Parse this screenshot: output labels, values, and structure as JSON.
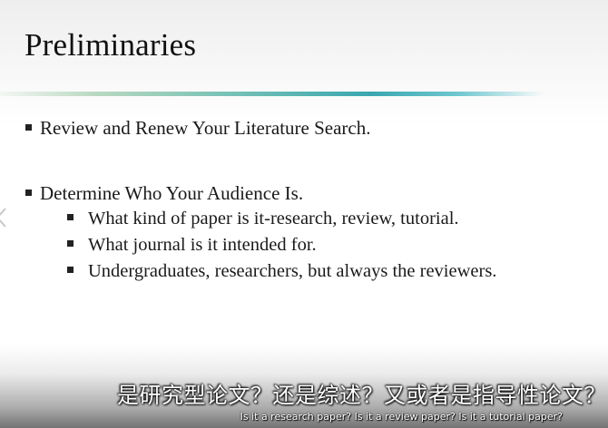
{
  "slide": {
    "title": "Preliminaries",
    "bullets": [
      {
        "text": "Review and Renew Your Literature Search."
      },
      {
        "text": "Determine Who Your Audience Is."
      }
    ],
    "sub_bullets": [
      {
        "text": "What kind of paper is it-research, review, tutorial."
      },
      {
        "text": "What journal is it intended for."
      },
      {
        "text": "Undergraduates, researchers, but always the reviewers."
      }
    ]
  },
  "subtitles": {
    "chinese": "是研究型论文？还是综述？又或者是指导性论文？",
    "english": "Is it a research paper? Is it a review paper? Is it a tutorial paper?"
  },
  "colors": {
    "accent": "#3aa7b0",
    "text": "#1a1a1a",
    "subtitle": "#ffffff"
  },
  "icons": {
    "bullet": "square-bullet-icon",
    "nav": "chevron-left-icon"
  }
}
